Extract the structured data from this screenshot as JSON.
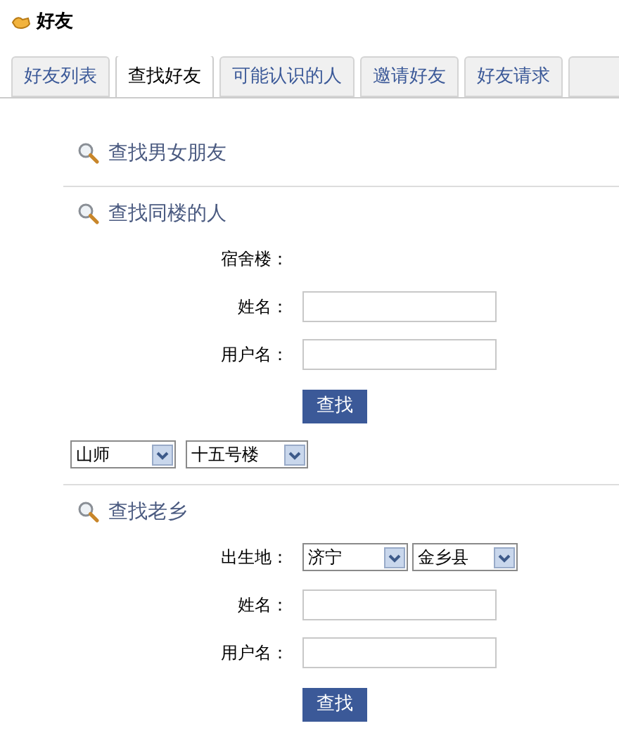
{
  "header": {
    "title": "好友"
  },
  "tabs": [
    {
      "label": "好友列表",
      "selected": false
    },
    {
      "label": "查找好友",
      "selected": true
    },
    {
      "label": "可能认识的人",
      "selected": false
    },
    {
      "label": "邀请好友",
      "selected": false
    },
    {
      "label": "好友请求",
      "selected": false
    }
  ],
  "sections": [
    {
      "kind": "link",
      "title": "查找男女朋友"
    },
    {
      "kind": "form",
      "title": "查找同楼的人",
      "rows": [
        {
          "kind": "label",
          "label": "宿舍楼："
        },
        {
          "kind": "input",
          "label": "姓名："
        },
        {
          "kind": "input",
          "label": "用户名："
        }
      ],
      "button": "查找",
      "dropdowns": [
        "山师",
        "十五号楼"
      ]
    },
    {
      "kind": "form",
      "title": "查找老乡",
      "rows": [
        {
          "kind": "selects",
          "label": "出生地：",
          "options": [
            "济宁",
            "金乡县"
          ]
        },
        {
          "kind": "input",
          "label": "姓名："
        },
        {
          "kind": "input",
          "label": "用户名："
        }
      ],
      "button": "查找"
    }
  ]
}
